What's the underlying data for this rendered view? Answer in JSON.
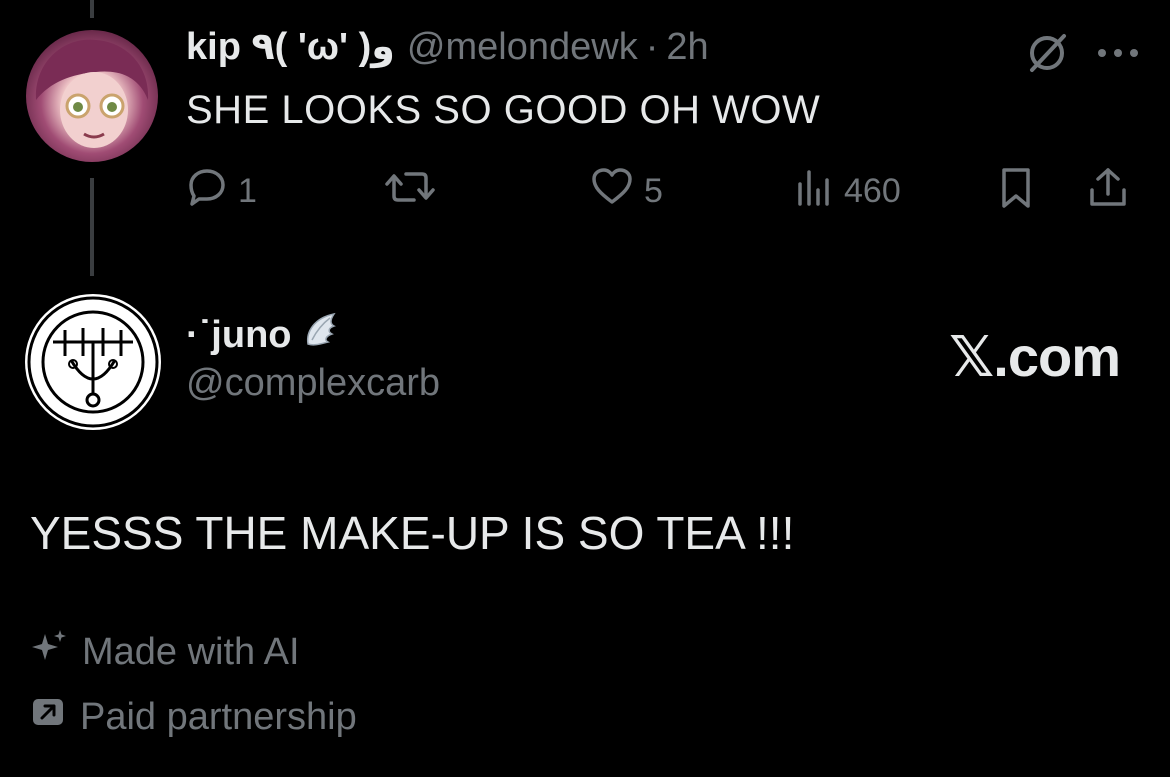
{
  "reply_post": {
    "display_name": "kip ٩( 'ω' )و",
    "handle": "@melondewk",
    "separator": "·",
    "time": "2h",
    "text": "SHE LOOKS SO GOOD OH WOW",
    "stats": {
      "replies": "1",
      "reposts": "",
      "likes": "5",
      "views": "460"
    },
    "icons": [
      "grok-icon",
      "more-icon",
      "reply-icon",
      "repost-icon",
      "like-icon",
      "views-icon",
      "bookmark-icon",
      "share-icon"
    ]
  },
  "main_post": {
    "display_name": "·˙juno",
    "handle": "@complexcarb",
    "brand": "𝕏.com",
    "text": "YESSS THE MAKE-UP IS SO TEA !!!",
    "labels": {
      "ai": "Made with AI",
      "paid": "Paid partnership"
    },
    "icons": [
      "wing-emoji",
      "sparkle-icon",
      "paid-partnership-icon"
    ]
  },
  "colors": {
    "background": "#000000",
    "primary_text": "#e7e9ea",
    "secondary_text": "#71767b",
    "thread_line": "#3a3d40"
  }
}
